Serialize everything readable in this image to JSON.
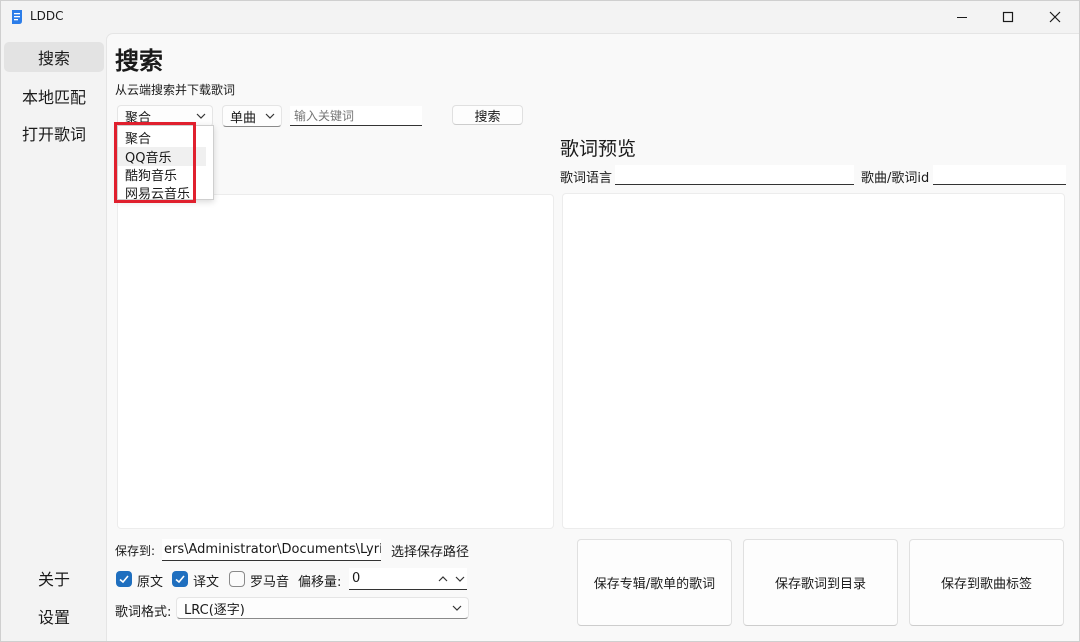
{
  "app": {
    "title": "LDDC"
  },
  "sidebar": {
    "items": [
      {
        "label": "搜索",
        "active": true
      },
      {
        "label": "本地匹配"
      },
      {
        "label": "打开歌词"
      }
    ],
    "bottom_items": [
      {
        "label": "关于"
      },
      {
        "label": "设置"
      }
    ]
  },
  "page": {
    "title": "搜索",
    "subtitle": "从云端搜索并下载歌词"
  },
  "search": {
    "source_value": "聚合",
    "type_value": "单曲",
    "keyword_placeholder": "输入关键词",
    "search_button": "搜索",
    "source_options": [
      "聚合",
      "QQ音乐",
      "酷狗音乐",
      "网易云音乐"
    ]
  },
  "preview": {
    "title": "歌词预览",
    "language_label": "歌词语言",
    "id_label": "歌曲/歌词id"
  },
  "save": {
    "path_label": "保存到:",
    "path_value": "ers\\Administrator\\Documents\\Lyrics",
    "choose_path_button": "选择保存路径",
    "options": [
      {
        "label": "原文",
        "checked": true
      },
      {
        "label": "译文",
        "checked": true
      },
      {
        "label": "罗马音",
        "checked": false
      }
    ],
    "offset_label": "偏移量:",
    "offset_value": "0",
    "format_label": "歌词格式:",
    "format_value": "LRC(逐字)",
    "action_buttons": [
      "保存专辑/歌单的歌词",
      "保存歌词到目录",
      "保存到歌曲标签"
    ]
  },
  "colors": {
    "accent": "#1f6fbf",
    "highlight": "#e0202e",
    "app_icon": "#2b7de9"
  }
}
